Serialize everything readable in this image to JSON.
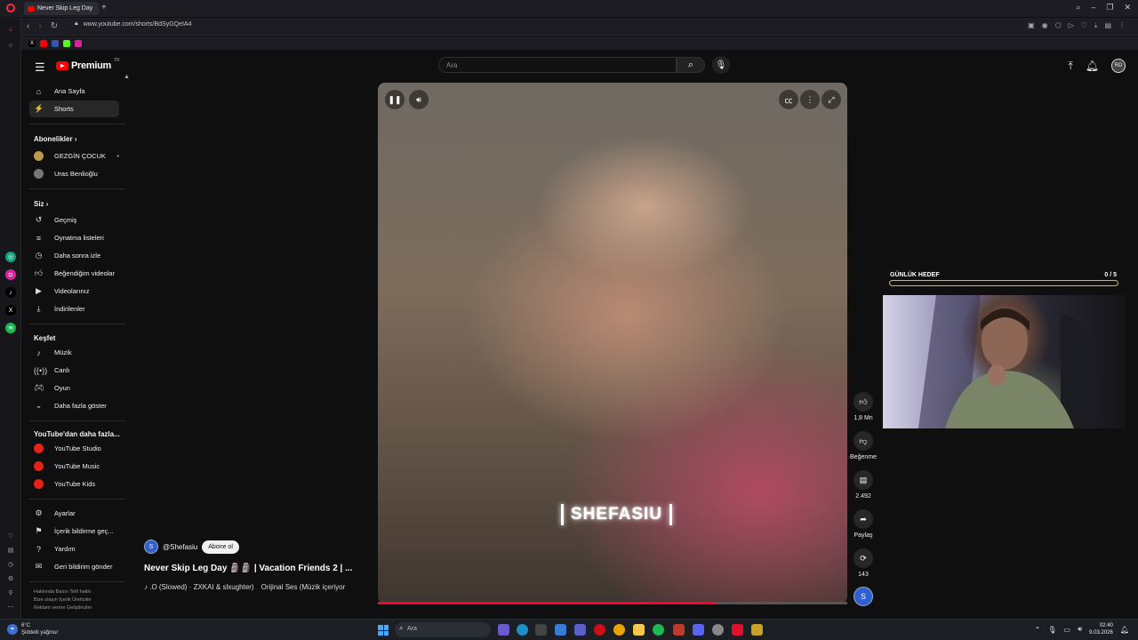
{
  "browser": {
    "tab_title": "Never Skip Leg Day",
    "url": "www.youtube.com/shorts/BdSyGQeIA4",
    "new_tab_symbol": "+"
  },
  "youtube": {
    "logo_text": "Premium",
    "logo_tr": "TR",
    "search_placeholder": "Ara",
    "sidebar": {
      "home": "Ana Sayfa",
      "shorts": "Shorts",
      "subscriptions_header": "Abonelikler",
      "subs": [
        "GEZGİN ÇOCUK",
        "Uras Benlioğlu"
      ],
      "you_header": "Siz",
      "you_items": [
        "Geçmiş",
        "Oynatma listeleri",
        "Daha sonra izle",
        "Beğendiğim videolar",
        "Videolarınız",
        "İndirilenler"
      ],
      "explore_header": "Keşfet",
      "explore_items": [
        "Müzik",
        "Canlı",
        "Oyun",
        "Daha fazla göster"
      ],
      "more_header": "YouTube'dan daha fazla...",
      "more_items": [
        "YouTube Studio",
        "YouTube Music",
        "YouTube Kids"
      ],
      "settings_items": [
        "Ayarlar",
        "İçerik bildirme geç...",
        "Yardım",
        "Geri bildirim gönder"
      ],
      "footer_line1": "Hakkında  Basın  Telif hakkı",
      "footer_line2": "Bize ulaşın  İçerik Üreticiler",
      "footer_line3": "Reklam verme  Geliştiriciler"
    },
    "video": {
      "caption": "SHEFASIU",
      "channel": "@Shefasiu",
      "subscribe": "Abone ol",
      "title": "Never Skip Leg Day 🗿🗿 | Vacation Friends 2 | ...",
      "sound_track": "♪ .O (Slowed) · ZXKAI & slxughter)",
      "sound_original": "Orijinal Ses (Müzik içeriyor",
      "progress_fraction": 0.72
    },
    "actions": {
      "likes": "1,8 Mn",
      "dislike": "Beğenme",
      "comments": "2.492",
      "share": "Paylaş",
      "remix": "143"
    }
  },
  "overlay": {
    "goal_label": "GÜNLÜK HEDEF",
    "goal_value": "0 / 5",
    "goal_fraction": 0
  },
  "taskbar": {
    "temp": "6°C",
    "weather": "Şiddetli yağmur",
    "search": "Ara",
    "time": "02:40",
    "date": "9.03.2026"
  }
}
